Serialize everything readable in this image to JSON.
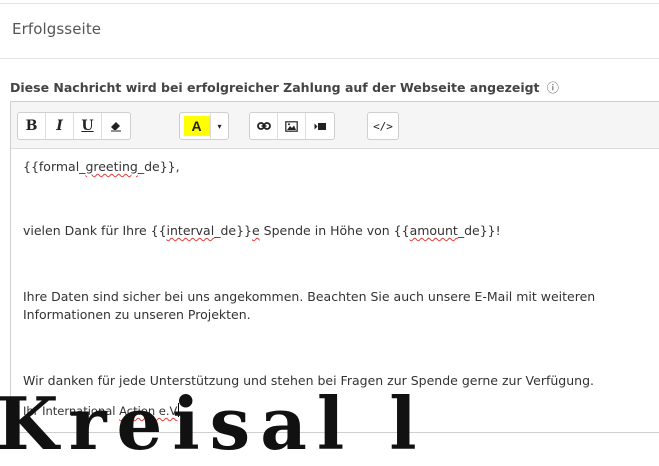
{
  "section": {
    "title": "Erfolgsseite"
  },
  "field": {
    "label": "Diese Nachricht wird bei erfolgreicher Zahlung auf der Webseite angezeigt",
    "info_icon": "ⓘ"
  },
  "toolbar": {
    "bold": "B",
    "italic": "I",
    "underline": "U",
    "eraser_icon": "eraser-icon",
    "text_color": "A",
    "caret": "▾",
    "link_icon": "link-icon",
    "image_icon": "image-icon",
    "video_icon": "video-icon",
    "code": "</>"
  },
  "editor": {
    "line1_a": "{{formal_",
    "line1_sq": "greeting",
    "line1_b": "_de}},",
    "line2_a": "vielen Dank für Ihre {{",
    "line2_sq1": "interval",
    "line2_b": "_de}}",
    "line2_sq2": "e",
    "line2_c": " Spende in Höhe von {{",
    "line2_sq3": "amount",
    "line2_d": "_de}}!",
    "line3a": "Ihre Daten sind sicher bei uns angekommen. Beachten Sie auch unsere E-Mail mit weiteren",
    "line3b": "Informationen zu unseren Projekten.",
    "line4": "Wir danken für jede Unterstützung und stehen bei Fragen zur Spende gerne zur Verfügung.",
    "line5_a": "Ihr International ",
    "line5_sq": "Action e.V",
    "overlay": "Kreisal l"
  },
  "colors": {
    "highlight": "#ffff00",
    "spellcheck": "#e03c3c"
  }
}
